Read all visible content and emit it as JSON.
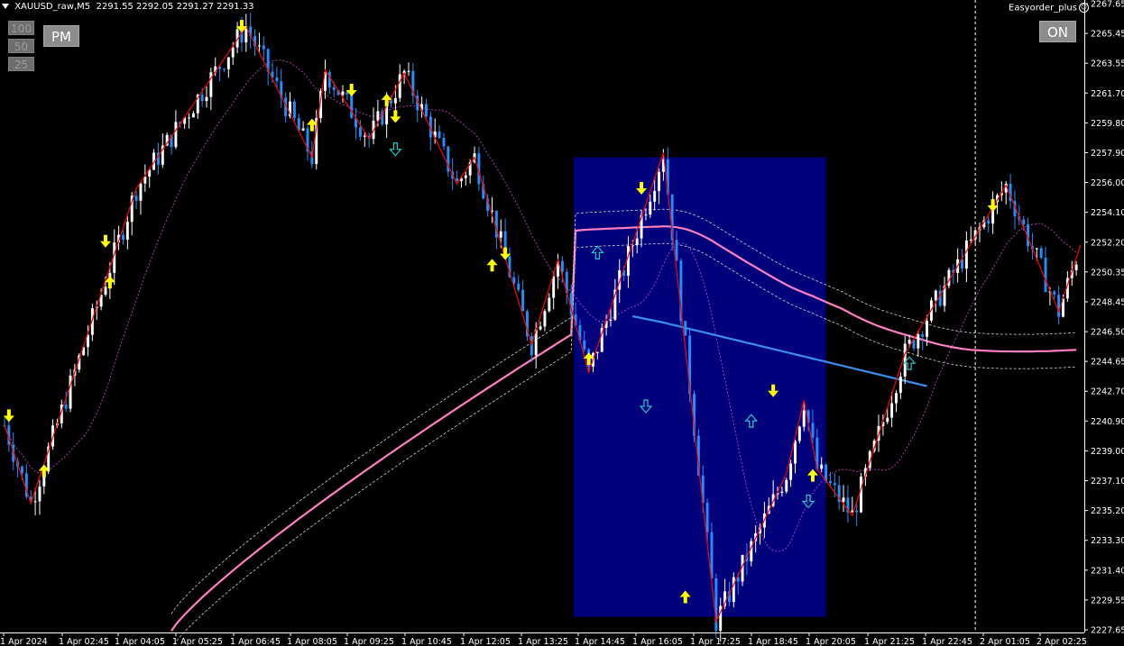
{
  "window": {
    "symbol_title": "XAUUSD_raw,M5",
    "ohlc": "2291.55 2292.05 2291.27 2291.33"
  },
  "lot_buttons": [
    "100",
    "50",
    "25"
  ],
  "pm_button": "PM",
  "ea": {
    "name": "Easyorder_plus",
    "status_icon": "smiley-icon",
    "toggle_label": "ON"
  },
  "colors": {
    "background": "#000000",
    "bull_candle": "#ffffff",
    "bear_candle": "#1e90ff",
    "zigzag": "#ff0000",
    "ma_pink": "#ff7fc0",
    "ma_blue": "#3a8ef0",
    "band": "#d0d0d0",
    "dotted_magenta": "#c040c0",
    "session_box": "#00007a",
    "arrow_yellow": "#ffff00",
    "arrow_cyan": "#22c8c8"
  },
  "chart_data": {
    "type": "candlestick",
    "symbol": "XAUUSD",
    "timeframe": "M5",
    "y_ticks": [
      "2267.65",
      "2265.45",
      "2263.55",
      "2261.70",
      "2259.80",
      "2257.90",
      "2256.00",
      "2254.10",
      "2252.20",
      "2250.35",
      "2248.45",
      "2246.50",
      "2244.65",
      "2242.70",
      "2240.90",
      "2239.00",
      "2237.10",
      "2235.20",
      "2233.30",
      "2231.40",
      "2229.55",
      "2227.65"
    ],
    "x_ticks": [
      "1 Apr 2024",
      "1 Apr 02:45",
      "1 Apr 04:05",
      "1 Apr 05:25",
      "1 Apr 06:45",
      "1 Apr 08:05",
      "1 Apr 09:25",
      "1 Apr 10:45",
      "1 Apr 12:05",
      "1 Apr 13:25",
      "1 Apr 14:45",
      "1 Apr 16:05",
      "1 Apr 17:25",
      "1 Apr 18:45",
      "1 Apr 20:05",
      "1 Apr 21:25",
      "1 Apr 22:45",
      "2 Apr 01:05",
      "2 Apr 02:25"
    ],
    "y_range": [
      2227.3,
      2267.9
    ],
    "bar_count": 245,
    "zigzag_path": [
      [
        0,
        2240.6
      ],
      [
        6,
        2235.6
      ],
      [
        30,
        2255.8
      ],
      [
        55,
        2266.2
      ],
      [
        70,
        2257.8
      ],
      [
        73,
        2263.4
      ],
      [
        83,
        2259.0
      ],
      [
        91,
        2263.2
      ],
      [
        103,
        2256.1
      ],
      [
        107,
        2257.8
      ],
      [
        120,
        2245.8
      ],
      [
        126,
        2251.2
      ],
      [
        133,
        2244.0
      ],
      [
        150,
        2258.1
      ],
      [
        162,
        2228.0
      ],
      [
        178,
        2237.5
      ],
      [
        182,
        2242.2
      ],
      [
        185,
        2237.8
      ],
      [
        193,
        2234.8
      ],
      [
        205,
        2245.2
      ],
      [
        228,
        2256.0
      ],
      [
        240,
        2247.9
      ],
      [
        245,
        2252.2
      ]
    ],
    "session_box": {
      "from_bar": 130,
      "to_bar": 187,
      "high": 2257.8,
      "low": 2228.3
    },
    "dashed_vertical_bar": 221,
    "arrows": [
      {
        "bar": 1,
        "price": 2241.1,
        "dir": "down",
        "color": "yellow"
      },
      {
        "bar": 9,
        "price": 2237.8,
        "dir": "up",
        "color": "yellow"
      },
      {
        "bar": 23,
        "price": 2252.3,
        "dir": "down",
        "color": "yellow"
      },
      {
        "bar": 24,
        "price": 2249.9,
        "dir": "up",
        "color": "yellow"
      },
      {
        "bar": 54,
        "price": 2266.1,
        "dir": "down",
        "color": "yellow"
      },
      {
        "bar": 70,
        "price": 2260.0,
        "dir": "up",
        "color": "yellow"
      },
      {
        "bar": 79,
        "price": 2262.0,
        "dir": "down",
        "color": "yellow"
      },
      {
        "bar": 87,
        "price": 2261.6,
        "dir": "up",
        "color": "yellow"
      },
      {
        "bar": 89,
        "price": 2260.3,
        "dir": "down",
        "color": "yellow"
      },
      {
        "bar": 89,
        "price": 2258.2,
        "dir": "down",
        "color": "cyan"
      },
      {
        "bar": 111,
        "price": 2251.0,
        "dir": "up",
        "color": "yellow"
      },
      {
        "bar": 114,
        "price": 2251.5,
        "dir": "down",
        "color": "yellow"
      },
      {
        "bar": 133,
        "price": 2245.0,
        "dir": "up",
        "color": "yellow"
      },
      {
        "bar": 135,
        "price": 2251.8,
        "dir": "up",
        "color": "cyan"
      },
      {
        "bar": 145,
        "price": 2255.7,
        "dir": "down",
        "color": "yellow"
      },
      {
        "bar": 146,
        "price": 2241.7,
        "dir": "down",
        "color": "cyan"
      },
      {
        "bar": 155,
        "price": 2229.7,
        "dir": "up",
        "color": "yellow"
      },
      {
        "bar": 170,
        "price": 2241.0,
        "dir": "up",
        "color": "cyan"
      },
      {
        "bar": 175,
        "price": 2242.7,
        "dir": "down",
        "color": "yellow"
      },
      {
        "bar": 183,
        "price": 2235.6,
        "dir": "down",
        "color": "cyan"
      },
      {
        "bar": 184,
        "price": 2237.5,
        "dir": "up",
        "color": "yellow"
      },
      {
        "bar": 206,
        "price": 2244.7,
        "dir": "up",
        "color": "cyan"
      },
      {
        "bar": 225,
        "price": 2254.6,
        "dir": "down",
        "color": "yellow"
      }
    ]
  }
}
